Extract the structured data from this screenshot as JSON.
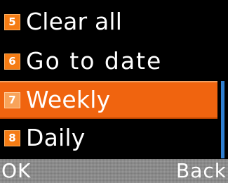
{
  "menu": {
    "items": [
      {
        "number": "5",
        "label": "Clear all",
        "selected": false
      },
      {
        "number": "6",
        "label": "Go to date",
        "selected": false
      },
      {
        "number": "7",
        "label": "Weekly",
        "selected": true
      },
      {
        "number": "8",
        "label": "Daily",
        "selected": false
      }
    ]
  },
  "softkeys": {
    "left": "OK",
    "right": "Back"
  },
  "colors": {
    "background": "#000000",
    "highlight": "#f0640f",
    "badge": "#f57c14",
    "scrollbar": "#2f7fd0",
    "softkey_bar": "#8a8a8a"
  }
}
